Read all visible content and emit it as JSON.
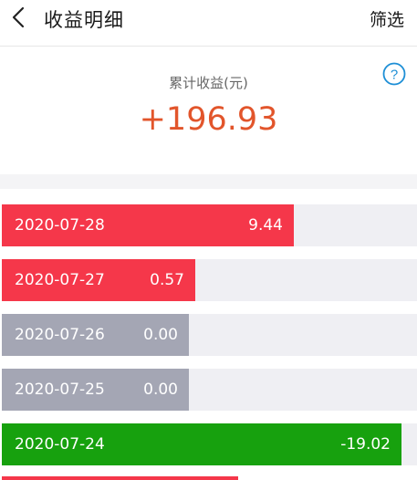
{
  "header": {
    "title": "收益明细",
    "filter_label": "筛选",
    "back_icon": "chevron-left-icon"
  },
  "summary": {
    "label": "累计收益(元)",
    "value": "+196.93",
    "help_icon": "question-circle-icon"
  },
  "colors": {
    "positive": "#f5374a",
    "zero": "#a4a6b4",
    "negative": "#17a10e",
    "accent": "#e2552b",
    "help": "#1e8fd6"
  },
  "records": [
    {
      "date": "2020-07-28",
      "amount": "9.44",
      "share": 0.703,
      "status": "positive"
    },
    {
      "date": "2020-07-27",
      "amount": "0.57",
      "share": 0.466,
      "status": "positive"
    },
    {
      "date": "2020-07-26",
      "amount": "0.00",
      "share": 0.451,
      "status": "zero"
    },
    {
      "date": "2020-07-25",
      "amount": "0.00",
      "share": 0.451,
      "status": "zero"
    },
    {
      "date": "2020-07-24",
      "amount": "-19.02",
      "share": 0.962,
      "status": "negative"
    }
  ]
}
